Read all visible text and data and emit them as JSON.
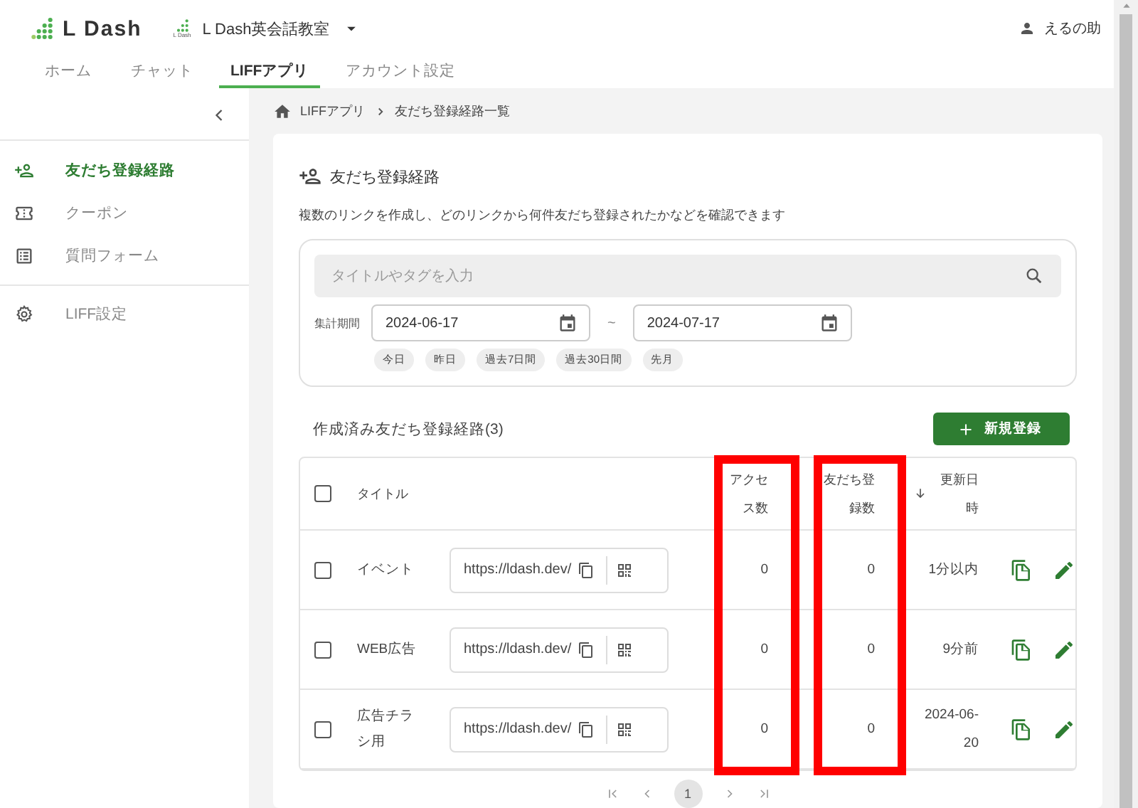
{
  "header": {
    "logo": "L Dash",
    "account_logo_text": "L Dash",
    "account_name": "L Dash英会話教室",
    "user_name": "えるの助"
  },
  "nav_tabs": [
    {
      "label": "ホーム",
      "selected": false
    },
    {
      "label": "チャット",
      "selected": false
    },
    {
      "label": "LIFFアプリ",
      "selected": true
    },
    {
      "label": "アカウント設定",
      "selected": false
    }
  ],
  "sidebar": {
    "items": [
      {
        "label": "友だち登録経路",
        "selected": true
      },
      {
        "label": "クーポン",
        "selected": false
      },
      {
        "label": "質問フォーム",
        "selected": false
      },
      {
        "label": "LIFF設定",
        "selected": false
      }
    ]
  },
  "breadcrumb": [
    "LIFFアプリ",
    "友だち登録経路一覧"
  ],
  "page": {
    "title": "友だち登録経路",
    "description": "複数のリンクを作成し、どのリンクから何件友だち登録されたかなどを確認できます",
    "search_placeholder": "タイトルやタグを入力",
    "period_label": "集計期間",
    "start_date": "2024-06-17",
    "range_separator": "~",
    "end_date": "2024-07-17",
    "quick_ranges": [
      "今日",
      "昨日",
      "過去7日間",
      "過去30日間",
      "先月"
    ],
    "list_title": "作成済み友だち登録経路(3)",
    "new_button": "新規登録"
  },
  "table": {
    "select_all_checked": false,
    "columns": [
      {
        "label": "タイトル",
        "highlighted": false
      },
      {
        "label": "アクセス数",
        "highlighted": true
      },
      {
        "label": "友だち登録数",
        "highlighted": true
      },
      {
        "label": "更新日時",
        "highlighted": false
      }
    ],
    "rows": [
      {
        "checked": false,
        "title": "イベント",
        "url": "https://ldash.dev/",
        "access": "0",
        "friends": "0",
        "updated": "1分以内"
      },
      {
        "checked": false,
        "title": "WEB広告",
        "url": "https://ldash.dev/",
        "access": "0",
        "friends": "0",
        "updated": "9分前"
      },
      {
        "checked": false,
        "title": "広告チラシ用",
        "url": "https://ldash.dev/",
        "access": "0",
        "friends": "0",
        "updated": "2024-06-20"
      }
    ]
  },
  "pagination": {
    "pages": [
      {
        "label": "1",
        "selected": true
      }
    ]
  }
}
